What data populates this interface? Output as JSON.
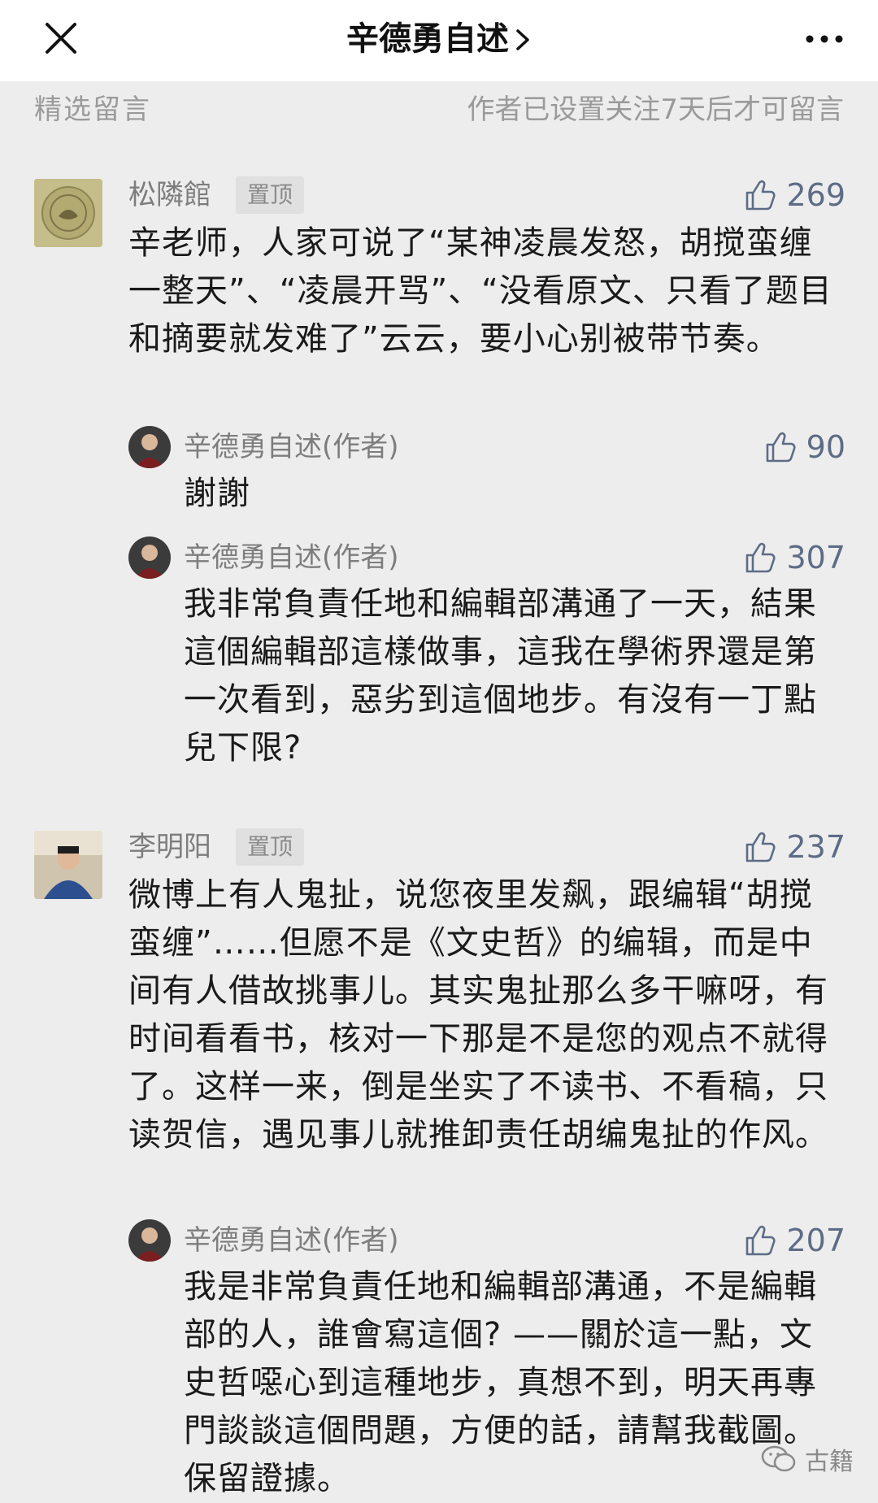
{
  "header": {
    "title": "辛德勇自述",
    "close_icon": "close-icon",
    "more_icon": "more-dots-icon"
  },
  "section": {
    "title": "精选留言",
    "notice": "作者已设置关注7天后才可留言"
  },
  "comments": [
    {
      "name": "松隣館",
      "badge": "置顶",
      "likes": "269",
      "text": "辛老师，人家可说了“某神凌晨发怒，胡搅蛮缠一整天”、“凌晨开骂”、“没看原文、只看了题目和摘要就发难了”云云，要小心别被带节奏。",
      "replies": [
        {
          "name": "辛德勇自述(作者)",
          "likes": "90",
          "text": "謝謝"
        },
        {
          "name": "辛德勇自述(作者)",
          "likes": "307",
          "text": "我非常負責任地和編輯部溝通了一天，結果這個編輯部這樣做事，這我在學術界還是第一次看到，惡劣到這個地步。有沒有一丁點兒下限?"
        }
      ]
    },
    {
      "name": "李明阳",
      "badge": "置顶",
      "likes": "237",
      "text": "微博上有人鬼扯，说您夜里发飙，跟编辑“胡搅蛮缠”……但愿不是《文史哲》的编辑，而是中间有人借故挑事儿。其实鬼扯那么多干嘛呀，有时间看看书，核对一下那是不是您的观点不就得了。这样一来，倒是坐实了不读书、不看稿，只读贺信，遇见事儿就推卸责任胡编鬼扯的作风。",
      "replies": [
        {
          "name": "辛德勇自述(作者)",
          "likes": "207",
          "text": "我是非常負責任地和編輯部溝通，不是編輯部的人，誰會寫這個? ——關於這一點，文史哲噁心到這種地步，真想不到，明天再專門談談這個問題，方便的話，請幫我截圖。保留證據。"
        }
      ]
    }
  ],
  "watermark": {
    "text": "古籍",
    "icon": "wechat-icon"
  },
  "colors": {
    "background": "#ededed",
    "like": "#5d6c86",
    "meta": "#7d7d7d"
  }
}
